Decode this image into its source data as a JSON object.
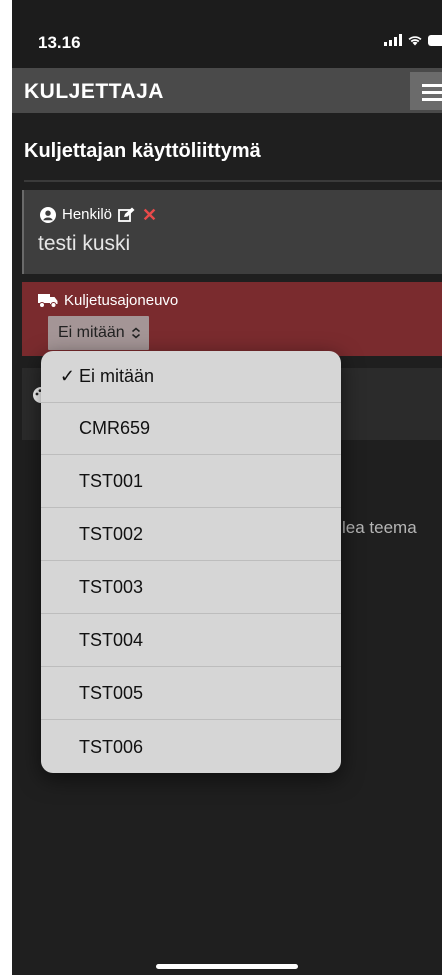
{
  "status_bar": {
    "time": "13.16"
  },
  "navbar": {
    "title": "KULJETTAJA"
  },
  "page": {
    "title": "Kuljettajan käyttöliittymä"
  },
  "person": {
    "label": "Henkilö",
    "name": "testi kuski"
  },
  "vehicle": {
    "label": "Kuljetusajoneuvo",
    "selected": "Ei mitään"
  },
  "theme": {
    "partial_text": "lea teema"
  },
  "dropdown": {
    "options": [
      {
        "label": "Ei mitään",
        "checked": "✓"
      },
      {
        "label": "CMR659",
        "checked": ""
      },
      {
        "label": "TST001",
        "checked": ""
      },
      {
        "label": "TST002",
        "checked": ""
      },
      {
        "label": "TST003",
        "checked": ""
      },
      {
        "label": "TST004",
        "checked": ""
      },
      {
        "label": "TST005",
        "checked": ""
      },
      {
        "label": "TST006",
        "checked": ""
      }
    ]
  },
  "colors": {
    "background": "#1f1f1f",
    "navbar": "#4a4a4a",
    "vehicle_card": "#7a2b2e",
    "delete_icon": "#e84a4a"
  },
  "icons": {
    "person": "user-circle-icon",
    "edit": "edit-icon",
    "delete": "close-icon",
    "vehicle": "truck-icon",
    "theme": "palette-icon",
    "menu": "hamburger-icon"
  }
}
